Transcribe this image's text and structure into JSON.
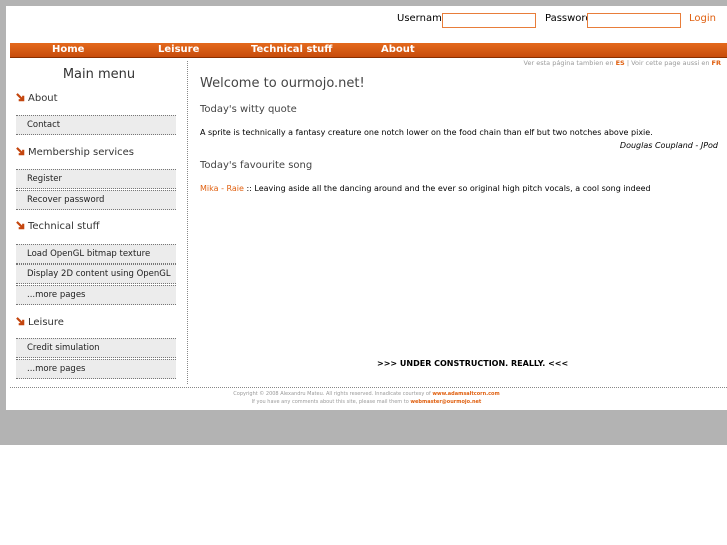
{
  "login": {
    "username_label": "Username",
    "username_value": "",
    "password_label": "Password",
    "password_value": "",
    "login_link": "Login"
  },
  "nav": {
    "home": "Home",
    "leisure": "Leisure",
    "technical": "Technical stuff",
    "about": "About"
  },
  "lang": {
    "es_text": "Ver esta página tambien en",
    "es_link": "ES",
    "separator": "|",
    "fr_text": "Voir cette page aussi en",
    "fr_link": "FR"
  },
  "sidebar": {
    "title": "Main menu",
    "about": {
      "label": "About",
      "items": [
        "Contact"
      ]
    },
    "membership": {
      "label": "Membership services",
      "items": [
        "Register",
        "Recover password"
      ]
    },
    "technical": {
      "label": "Technical stuff",
      "items": [
        "Load OpenGL bitmap texture",
        "Display 2D content using OpenGL",
        "...more pages"
      ]
    },
    "leisure": {
      "label": "Leisure",
      "items": [
        "Credit simulation",
        "...more pages"
      ]
    }
  },
  "main": {
    "welcome": "Welcome to ourmojo.net!",
    "quote_heading": "Today's witty quote",
    "quote_text": "A sprite is technically a fantasy creature one notch lower on the food chain than elf but two notches above pixie.",
    "quote_author": "Douglas Coupland - JPod",
    "song_heading": "Today's favourite song",
    "song_link": "Mika - Raie",
    "song_text": " :: Leaving aside all the dancing around and the ever so original high pitch vocals, a cool song indeed",
    "construction": ">>> UNDER CONSTRUCTION. REALLY. <<<"
  },
  "footer": {
    "line1_text": "Copyright © 2008 Alexandru Mateu. All rights reserved. Innadicate courtesy of",
    "line1_link": "www.adamsaltcorn.com",
    "line2_text": "If you have any comments about this site, please mail them to",
    "line2_link": "webmaster@ourmojo.net"
  },
  "colors": {
    "accent": "#e06010",
    "nav_bar": "#d55a14"
  }
}
